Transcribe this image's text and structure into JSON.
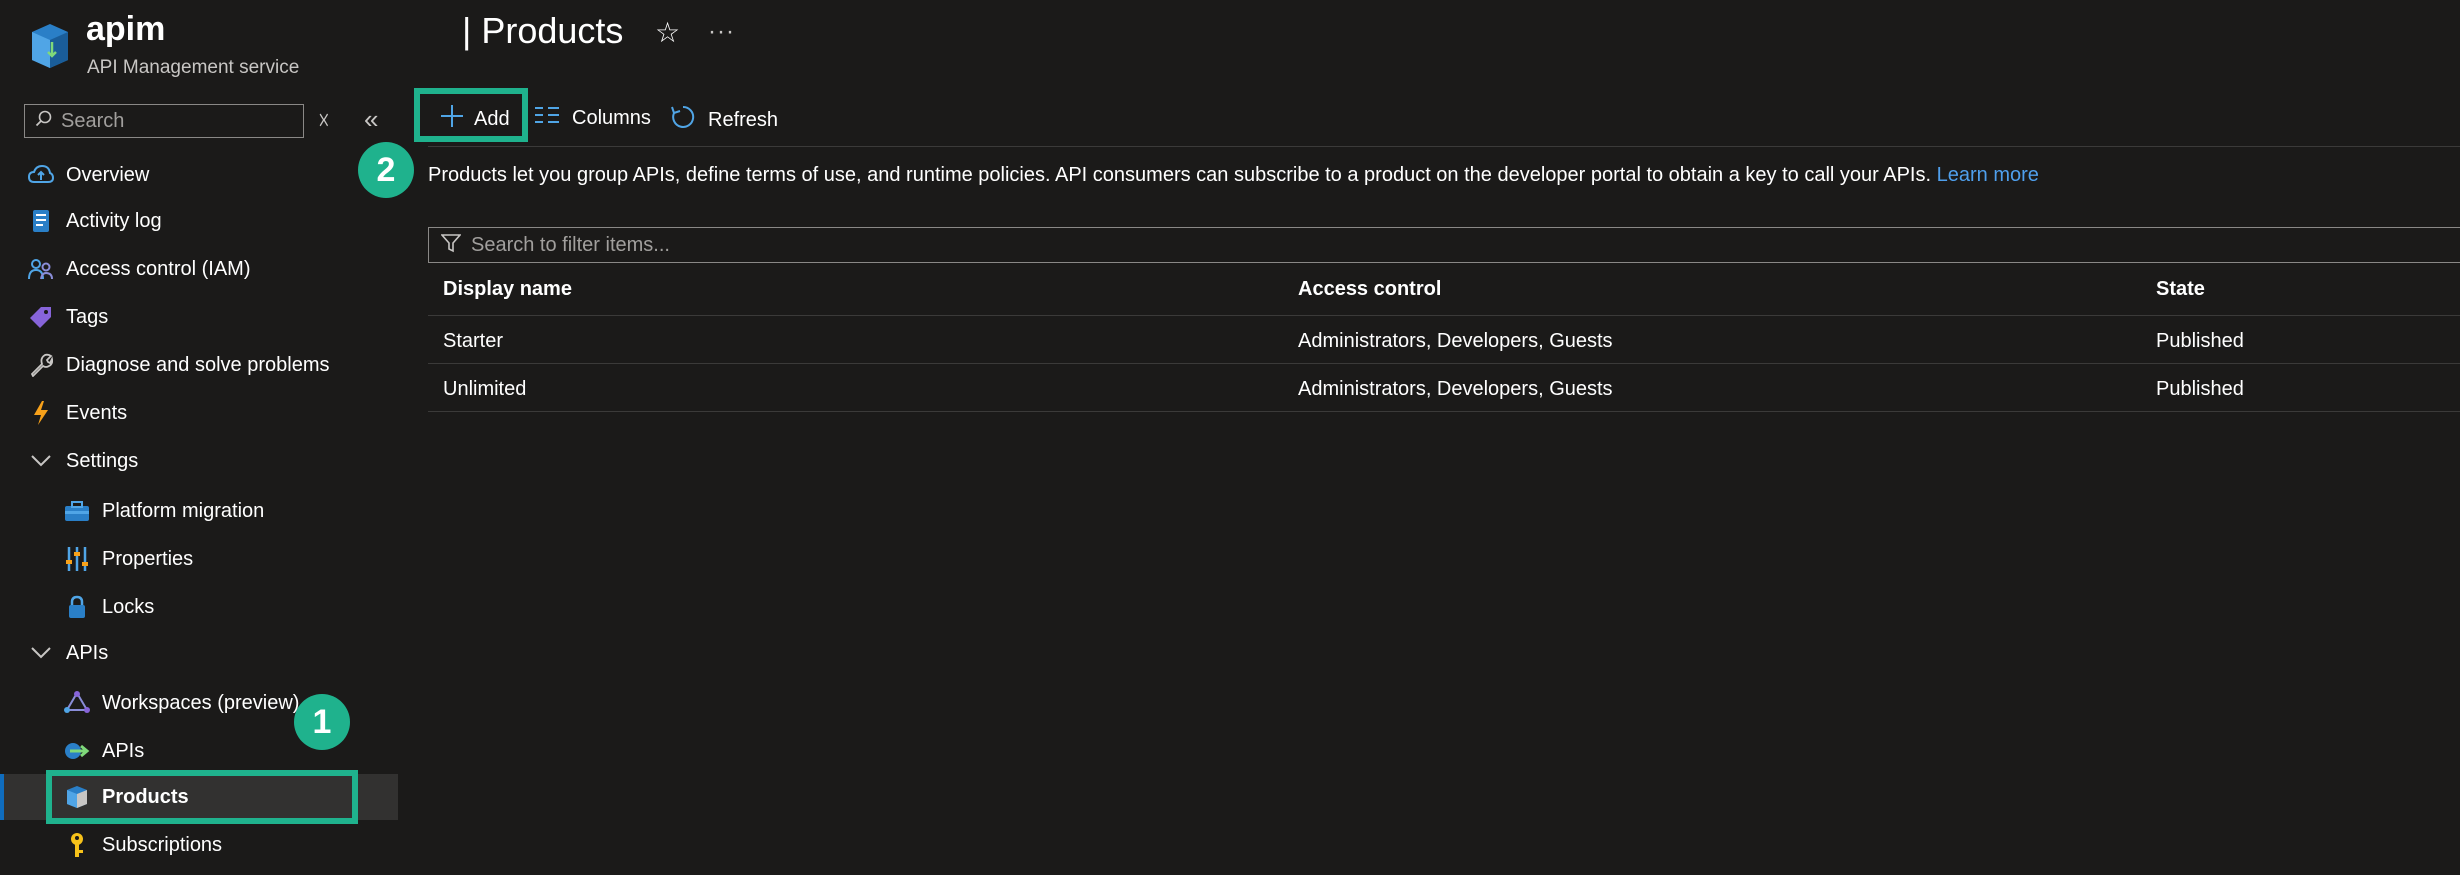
{
  "header": {
    "resource_name": "apim",
    "resource_type": "API Management service",
    "page_title": "| Products",
    "favorite_glyph": "☆",
    "more_glyph": "···"
  },
  "sidebar": {
    "search_placeholder": "Search",
    "clear_glyph": "☓",
    "collapse_glyph": "«",
    "items": [
      {
        "label": "Overview",
        "icon": "cloud-icon"
      },
      {
        "label": "Activity log",
        "icon": "activity-log-icon"
      },
      {
        "label": "Access control (IAM)",
        "icon": "people-icon"
      },
      {
        "label": "Tags",
        "icon": "tag-icon"
      },
      {
        "label": "Diagnose and solve problems",
        "icon": "wrench-icon"
      },
      {
        "label": "Events",
        "icon": "lightning-icon"
      },
      {
        "label": "Settings",
        "icon": "chevron-down-icon"
      },
      {
        "label": "Platform migration",
        "icon": "toolbox-icon"
      },
      {
        "label": "Properties",
        "icon": "sliders-icon"
      },
      {
        "label": "Locks",
        "icon": "lock-icon"
      },
      {
        "label": "APIs",
        "icon": "chevron-down-icon"
      },
      {
        "label": "Workspaces (preview)",
        "icon": "workspaces-icon"
      },
      {
        "label": "APIs",
        "icon": "api-arrow-icon"
      },
      {
        "label": "Products",
        "icon": "product-box-icon",
        "active": true
      },
      {
        "label": "Subscriptions",
        "icon": "key-icon"
      }
    ]
  },
  "toolbar": {
    "add_label": "Add",
    "columns_label": "Columns",
    "refresh_label": "Refresh"
  },
  "callouts": {
    "step1": "1",
    "step2": "2"
  },
  "main": {
    "description": "Products let you group APIs, define terms of use, and runtime policies. API consumers can subscribe to a product on the developer portal to obtain a key to call your APIs.",
    "learn_more": "Learn more",
    "filter_placeholder": "Search to filter items...",
    "table": {
      "columns": [
        "Display name",
        "Access control",
        "State"
      ],
      "rows": [
        {
          "name": "Starter",
          "access": "Administrators, Developers, Guests",
          "state": "Published"
        },
        {
          "name": "Unlimited",
          "access": "Administrators, Developers, Guests",
          "state": "Published"
        }
      ]
    }
  },
  "colors": {
    "background": "#1b1a19",
    "highlight": "#1fb28d",
    "link": "#4f9fec",
    "azure_blue": "#0f6cbd"
  }
}
